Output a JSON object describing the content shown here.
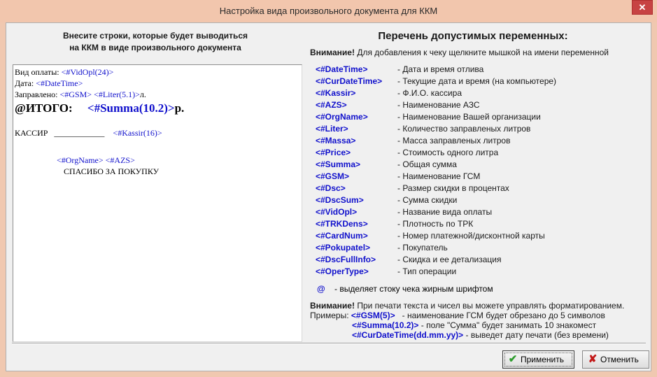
{
  "window": {
    "title": "Настройка вида произвольного документа для ККМ",
    "close_label": "✕"
  },
  "left": {
    "header_line1": "Внесите строки, которые будет выводиться",
    "header_line2": "на ККМ в виде произвольного документа",
    "editor": {
      "line1_text": "Вид оплаты: ",
      "line1_var": "<#VidOpl(24)>",
      "line2_text": "Дата: ",
      "line2_var": "<#DateTime>",
      "line3_text": "Заправлено: ",
      "line3_var1": "<#GSM>",
      "line3_var2": "<#Liter(5.1)>",
      "line3_suffix": "л.",
      "line4_text": "@ИТОГО:",
      "line4_var": "<#Summa(10.2)>",
      "line4_suffix": "р.",
      "line5_text": "КАССИР",
      "line5_blank": "____________",
      "line5_var": "<#Kassir(16)>",
      "line6_var1": "<#OrgName>",
      "line6_var2": "<#AZS>",
      "line7_text": "СПАСИБО ЗА ПОКУПКУ"
    }
  },
  "right": {
    "title": "Перечень допустимых переменных:",
    "note_bold": "Внимание!",
    "note_text": "Для добавления к чеку щелкните мышкой на имени переменной",
    "variables": [
      {
        "name": "<#DateTime>",
        "desc": "- Дата и время отлива"
      },
      {
        "name": "<#CurDateTime>",
        "desc": "- Текущие дата и время (на компьютере)"
      },
      {
        "name": "<#Kassir>",
        "desc": "- Ф.И.О. кассира"
      },
      {
        "name": "<#AZS>",
        "desc": "- Наименование АЗС"
      },
      {
        "name": "<#OrgName>",
        "desc": "- Наименование Вашей организации"
      },
      {
        "name": "<#Liter>",
        "desc": "- Количество заправленых литров"
      },
      {
        "name": "<#Massa>",
        "desc": "- Масса заправленых литров"
      },
      {
        "name": "<#Price>",
        "desc": "- Стоимость одного литра"
      },
      {
        "name": "<#Summa>",
        "desc": "- Общая сумма"
      },
      {
        "name": "<#GSM>",
        "desc": "- Наименование ГСМ"
      },
      {
        "name": "<#Dsc>",
        "desc": "- Размер скидки в процентах"
      },
      {
        "name": "<#DscSum>",
        "desc": "- Сумма скидки"
      },
      {
        "name": "<#VidOpl>",
        "desc": "- Название вида оплаты"
      },
      {
        "name": "<#TRKDens>",
        "desc": "- Плотность по ТРК"
      },
      {
        "name": "<#CardNum>",
        "desc": "- Номер платежной/дисконтной карты"
      },
      {
        "name": "<#Pokupatel>",
        "desc": "- Покупатель"
      },
      {
        "name": "<#DscFullInfo>",
        "desc": "- Скидка и ее детализация"
      },
      {
        "name": "<#OperType>",
        "desc": "- Тип операции"
      }
    ],
    "at_symbol": "@",
    "at_desc": "- выделяет стоку чека жирным шрифтом",
    "fmt_bold": "Внимание!",
    "fmt_text": "При печати текста и чисел вы можете управлять форматированием.",
    "ex_label": "Примеры:",
    "ex1_var": "<#GSM(5)>",
    "ex1_desc": "- наименование ГСМ будет обрезано до 5 символов",
    "ex2_var": "<#Summa(10.2)>",
    "ex2_desc": "- поле \"Сумма\" будет занимать 10 знакомест",
    "ex3_var": "<#CurDateTime(dd.mm.yy)>",
    "ex3_desc": "- выведет дату печати (без времени)"
  },
  "buttons": {
    "apply_label": "Применить",
    "apply_icon": "check-icon",
    "cancel_label": "Отменить",
    "cancel_icon": "x-icon"
  }
}
